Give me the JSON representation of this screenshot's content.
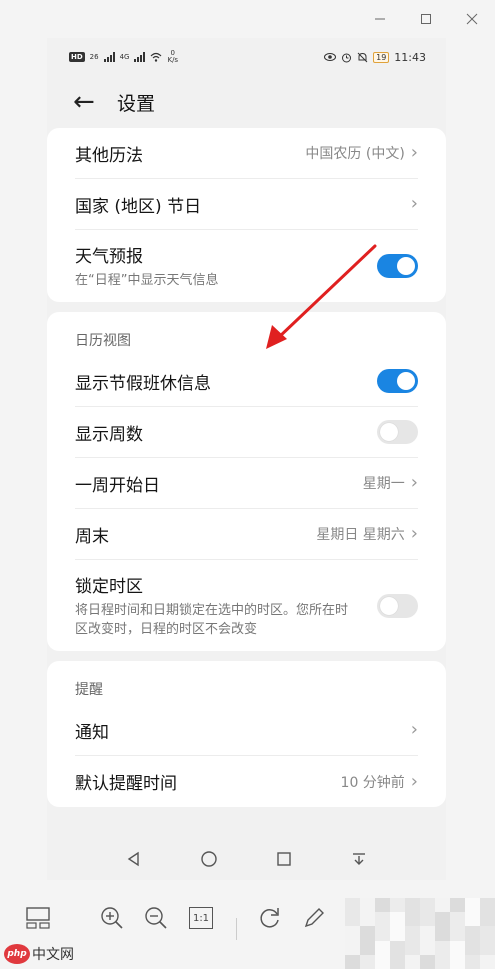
{
  "status_bar": {
    "hd": "HD",
    "net1": "26",
    "net2": "4G",
    "speed_value": "0",
    "speed_unit": "K/s",
    "battery": "19",
    "time": "11:43"
  },
  "header": {
    "title": "设置"
  },
  "group1": {
    "rows": [
      {
        "label": "其他历法",
        "value": "中国农历 (中文)"
      },
      {
        "label": "国家 (地区) 节日",
        "value": ""
      },
      {
        "label": "天气预报",
        "sub": "在“日程”中显示天气信息",
        "toggle": true
      }
    ]
  },
  "group2": {
    "title": "日历视图",
    "rows": [
      {
        "label": "显示节假班休信息",
        "toggle": true
      },
      {
        "label": "显示周数",
        "toggle": false
      },
      {
        "label": "一周开始日",
        "value": "星期一"
      },
      {
        "label": "周末",
        "value": "星期日 星期六"
      },
      {
        "label": "锁定时区",
        "sub": "将日程时间和日期锁定在选中的时区。您所在时区改变时，日程的时区不会改变",
        "toggle": false
      }
    ]
  },
  "group3": {
    "title": "提醒",
    "rows": [
      {
        "label": "通知",
        "value": ""
      },
      {
        "label": "默认提醒时间",
        "value": "10 分钟前"
      }
    ]
  },
  "toolbar": {
    "zoom_1to1": "1:1"
  },
  "watermark": {
    "logo": "php",
    "text": "中文网"
  },
  "colors": {
    "accent": "#1a85e2",
    "arrow": "#e02020",
    "toggle_off": "#e6e6e6"
  }
}
